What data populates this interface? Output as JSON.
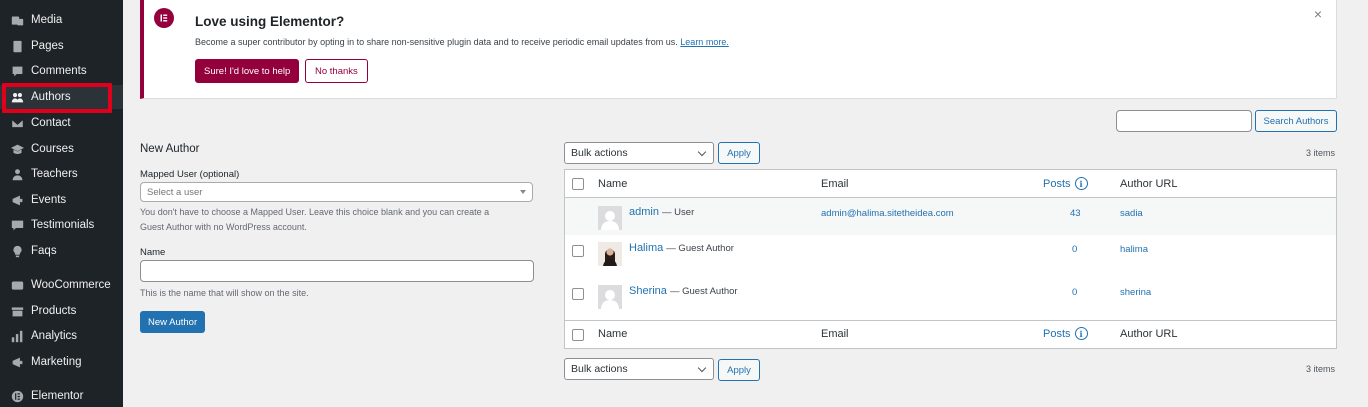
{
  "sidebar": {
    "items": [
      {
        "label": "Media",
        "icon": "media-icon"
      },
      {
        "label": "Pages",
        "icon": "pages-icon"
      },
      {
        "label": "Comments",
        "icon": "comments-icon"
      },
      {
        "label": "Authors",
        "icon": "authors-icon"
      },
      {
        "label": "Contact",
        "icon": "contact-icon"
      },
      {
        "label": "Courses",
        "icon": "courses-icon"
      },
      {
        "label": "Teachers",
        "icon": "teachers-icon"
      },
      {
        "label": "Events",
        "icon": "events-icon"
      },
      {
        "label": "Testimonials",
        "icon": "testimonials-icon"
      },
      {
        "label": "Faqs",
        "icon": "faqs-icon"
      },
      {
        "label": "WooCommerce",
        "icon": "woocommerce-icon"
      },
      {
        "label": "Products",
        "icon": "products-icon"
      },
      {
        "label": "Analytics",
        "icon": "analytics-icon"
      },
      {
        "label": "Marketing",
        "icon": "marketing-icon"
      },
      {
        "label": "Elementor",
        "icon": "elementor-icon"
      }
    ],
    "active": "Authors"
  },
  "notice": {
    "title": "Love using Elementor?",
    "text": "Become a super contributor by opting in to share non-sensitive plugin data and to receive periodic email updates from us.",
    "link": "Learn more.",
    "accept": "Sure! I'd love to help",
    "decline": "No thanks",
    "close": "×",
    "accent": "#93003c"
  },
  "search": {
    "value": "",
    "button": "Search Authors"
  },
  "form": {
    "heading": "New Author",
    "mapped_label": "Mapped User (optional)",
    "mapped_placeholder": "Select a user",
    "mapped_help_1": "You don't have to choose a Mapped User. Leave this choice blank and you can create a",
    "mapped_help_2": "Guest Author with no WordPress account.",
    "name_label": "Name",
    "name_value": "",
    "name_help": "This is the name that will show on the site.",
    "submit": "New Author"
  },
  "table": {
    "bulk_actions": "Bulk actions",
    "apply": "Apply",
    "count": "3 items",
    "columns": {
      "name": "Name",
      "email": "Email",
      "posts": "Posts",
      "url": "Author URL"
    },
    "rows": [
      {
        "name": "admin",
        "role": "— User",
        "email": "admin@halima.sitetheidea.com",
        "posts": "43",
        "url": "sadia"
      },
      {
        "name": "Halima",
        "role": "— Guest Author",
        "email": "",
        "posts": "0",
        "url": "halima"
      },
      {
        "name": "Sherina",
        "role": "— Guest Author",
        "email": "",
        "posts": "0",
        "url": "sherina"
      }
    ]
  },
  "colors": {
    "sidebar_bg": "#1d2327",
    "link": "#2271b1",
    "highlight": "#e0001b"
  }
}
